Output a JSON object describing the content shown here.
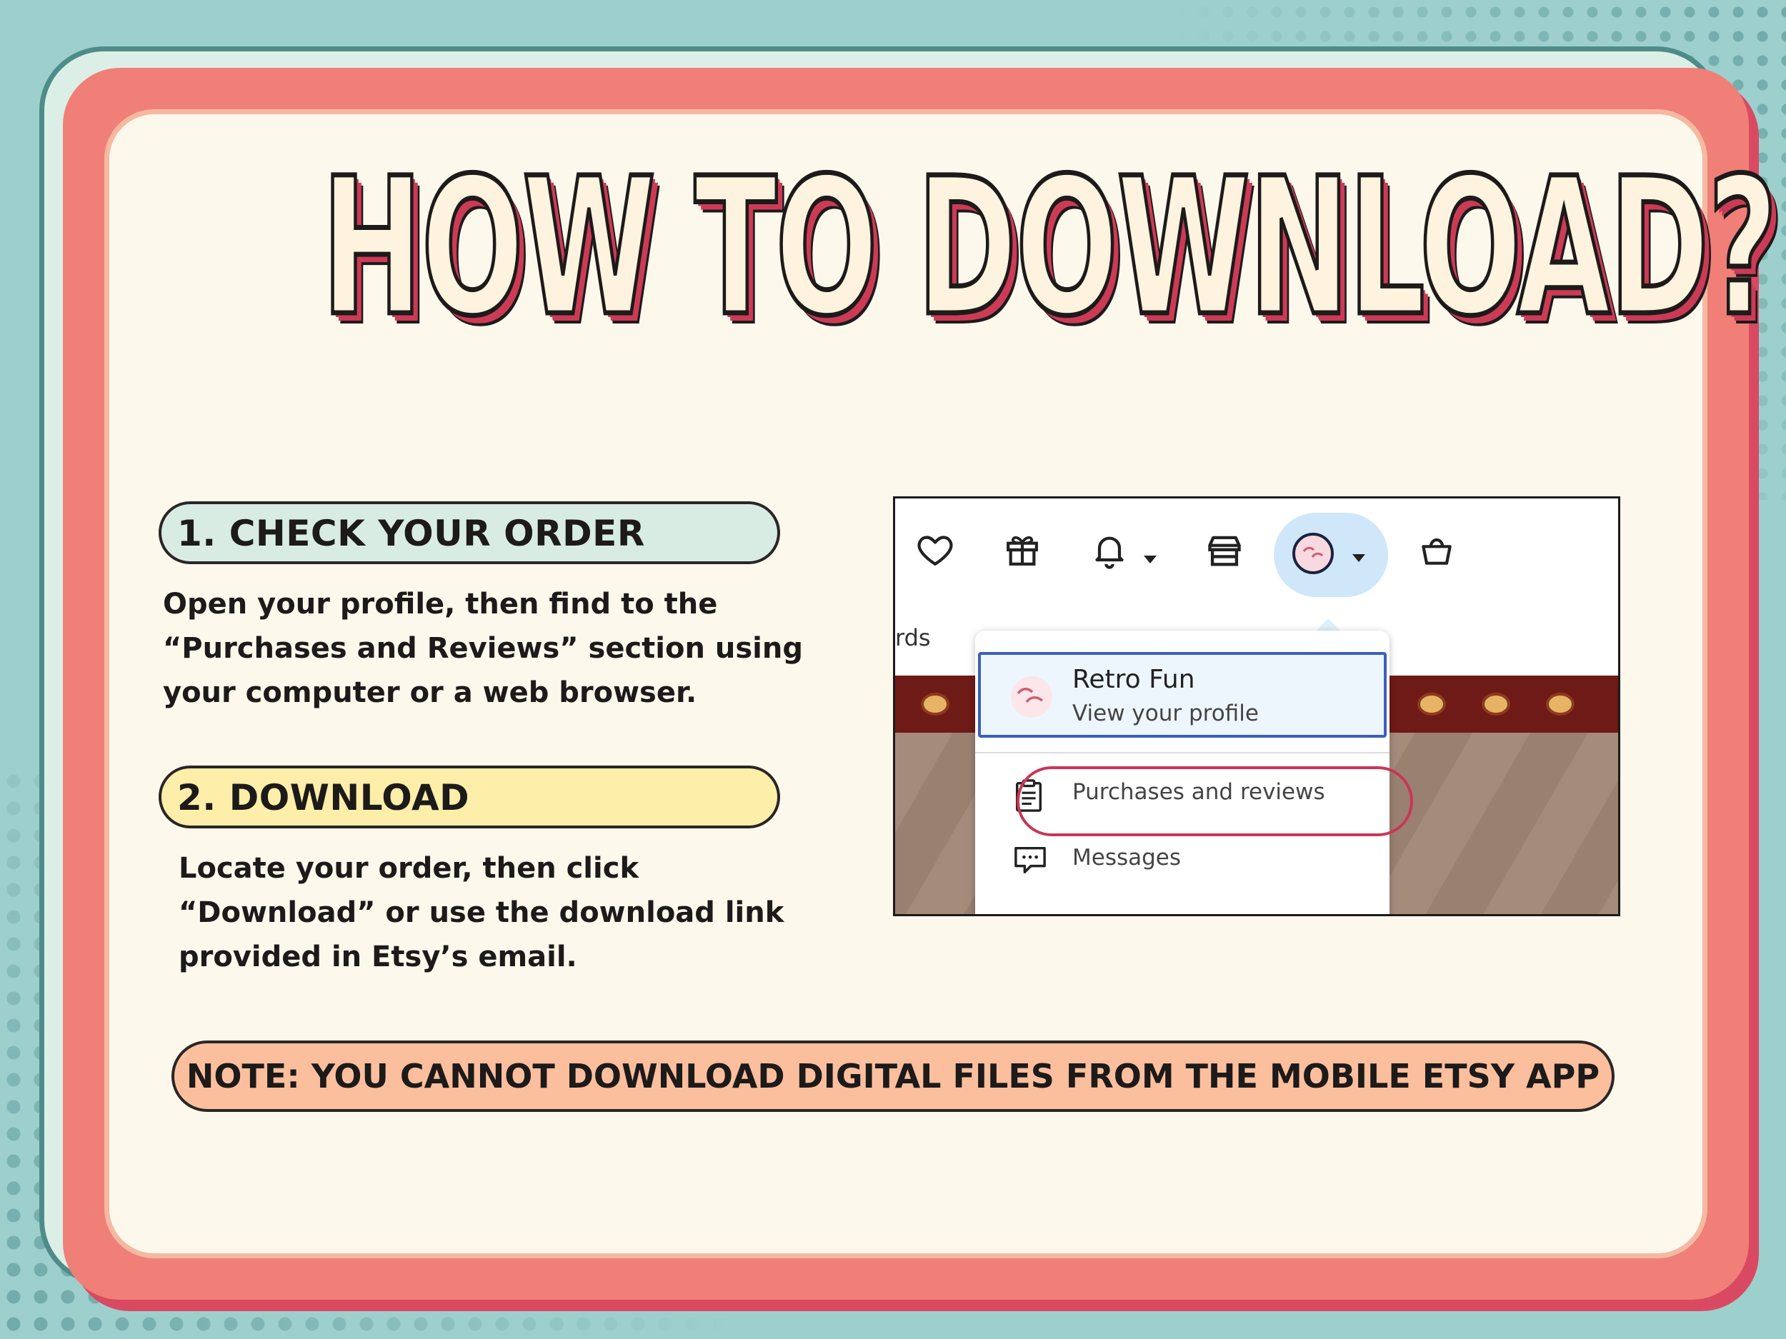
{
  "headline": "HOW TO DOWNLOAD?",
  "steps": [
    {
      "title": "1. CHECK YOUR ORDER",
      "lines": [
        "Open your profile, then find to the",
        "“Purchases and Reviews” section using",
        "your computer or a web browser."
      ]
    },
    {
      "title": "2. DOWNLOAD",
      "lines": [
        "Locate your order, then click",
        "“Download” or use the download link",
        "provided in Etsy’s email."
      ]
    }
  ],
  "note": "NOTE: YOU CANNOT DOWNLOAD DIGITAL FILES FROM THE MOBILE ETSY APP",
  "screenshot": {
    "toolbar_icons": [
      "heart-icon",
      "gift-icon",
      "bell-icon",
      "store-icon",
      "avatar",
      "basket-icon"
    ],
    "partial_label": "rds",
    "profile": {
      "name": "Retro Fun",
      "subtitle": "View your profile"
    },
    "menu": [
      {
        "label": "Purchases and reviews",
        "icon": "clipboard-icon"
      },
      {
        "label": "Messages",
        "icon": "chat-icon"
      }
    ]
  },
  "colors": {
    "background_teal": "#9dcfcd",
    "frame_coral": "#f07f78",
    "panel_cream": "#fdf8ec",
    "step1_pill": "#d8ece4",
    "step2_pill": "#fdeeaa",
    "note_pill": "#fbbf9e",
    "headline_shadow": "#cc3b56",
    "highlight_ring": "#c93656",
    "profile_border": "#3b5fc0"
  }
}
